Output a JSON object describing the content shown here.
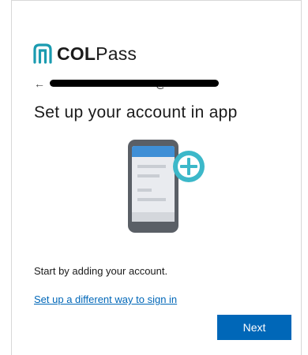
{
  "brand": {
    "name_bold": "COL",
    "name_regular": "Pass",
    "logo_icon": "colpass-logo-icon",
    "color": "#1a9bb0"
  },
  "account": {
    "back_icon": "back-arrow-icon",
    "back_glyph": "←",
    "email_visible": "@"
  },
  "page": {
    "title": "Set up your account in app",
    "illustration_icon": "phone-add-account-icon",
    "description": "Start by adding your account.",
    "alt_link": "Set up a different way to sign in",
    "next_label": "Next"
  },
  "colors": {
    "primary_button": "#0067b8",
    "link": "#0067b8",
    "accent": "#3cb8c9"
  }
}
